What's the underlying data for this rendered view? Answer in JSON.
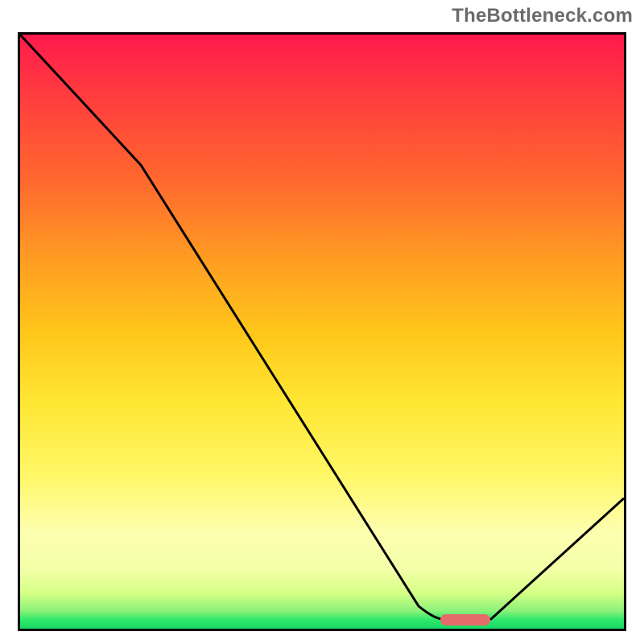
{
  "watermark": "TheBottleneck.com",
  "chart_data": {
    "type": "line",
    "title": "",
    "xlabel": "",
    "ylabel": "",
    "xlim": [
      0,
      100
    ],
    "ylim": [
      0,
      100
    ],
    "grid": false,
    "legend": false,
    "background": "rainbow-vertical",
    "series": [
      {
        "name": "bottleneck-curve",
        "x": [
          0,
          20,
          66,
          70,
          78,
          100
        ],
        "y": [
          100,
          78,
          4,
          2,
          2,
          22
        ]
      }
    ],
    "marker": {
      "name": "optimal-point",
      "shape": "pill",
      "x": 74,
      "y": 2,
      "width_pct": 8,
      "color": "#e66a6a"
    },
    "gradient_stops": [
      {
        "pct": 0,
        "color": "#ff1a4d"
      },
      {
        "pct": 25,
        "color": "#ff6a2e"
      },
      {
        "pct": 50,
        "color": "#ffc61a"
      },
      {
        "pct": 75,
        "color": "#fff766"
      },
      {
        "pct": 97,
        "color": "#8cf27a"
      },
      {
        "pct": 100,
        "color": "#18d765"
      }
    ]
  }
}
